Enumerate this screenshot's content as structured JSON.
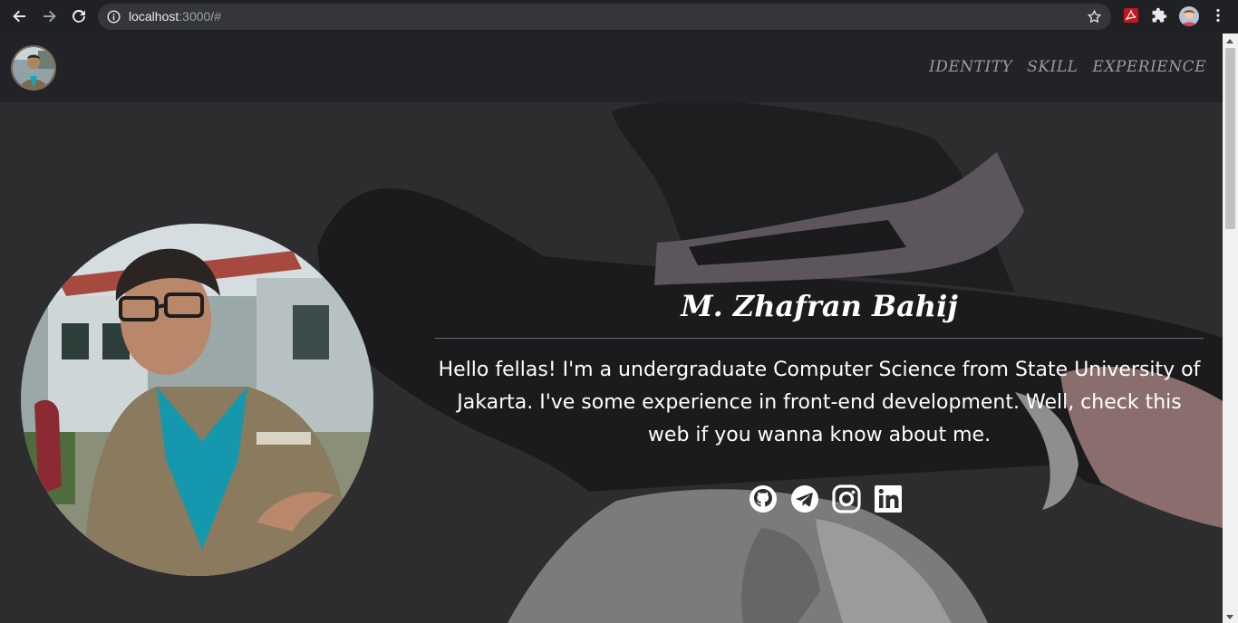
{
  "browser": {
    "url_host": "localhost",
    "url_rest": ":3000/#"
  },
  "navbar": {
    "links": [
      {
        "label": "IDENTITY"
      },
      {
        "label": "SKILL"
      },
      {
        "label": "EXPERIENCE"
      }
    ]
  },
  "hero": {
    "name": "M. Zhafran Bahij",
    "bio": "Hello fellas! I'm a undergraduate Computer Science from State University of Jakarta. I've some experience in front-end development. Well, check this web if you wanna know about me."
  },
  "socials": [
    {
      "icon": "github-icon"
    },
    {
      "icon": "telegram-icon"
    },
    {
      "icon": "instagram-icon"
    },
    {
      "icon": "linkedin-icon"
    }
  ],
  "colors": {
    "navbar_bg": "#212326",
    "page_bg": "#2d2d2f",
    "text": "#ffffff",
    "nav_link": "#9a9ca1"
  }
}
